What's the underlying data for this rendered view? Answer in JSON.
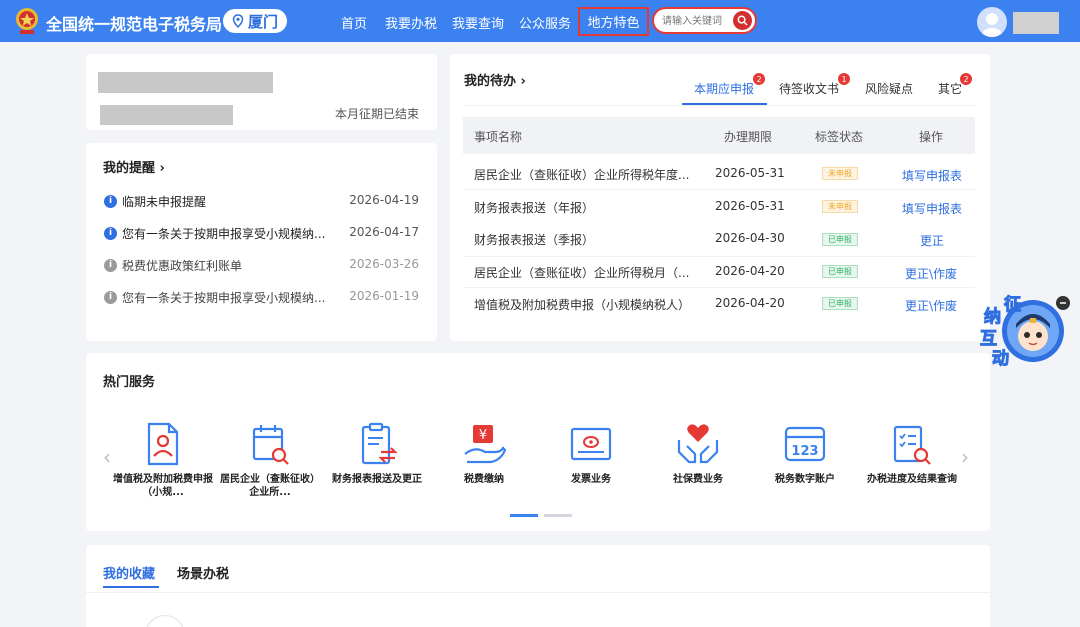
{
  "header": {
    "brand": "全国统一规范电子税务局",
    "city": "厦门",
    "nav": [
      "首页",
      "我要办税",
      "我要查询",
      "公众服务",
      "地方特色"
    ],
    "search_placeholder": "请输入关键词"
  },
  "profile": {
    "status": "本月征期已结束"
  },
  "reminders": {
    "title": "我的提醒",
    "items": [
      {
        "text": "临期未申报提醒",
        "date": "2026-04-19",
        "unread": true
      },
      {
        "text": "您有一条关于按期申报享受小规模纳...",
        "date": "2026-04-17",
        "unread": true
      },
      {
        "text": "税费优惠政策红利账单",
        "date": "2026-03-26",
        "unread": false
      },
      {
        "text": "您有一条关于按期申报享受小规模纳...",
        "date": "2026-01-19",
        "unread": false
      }
    ]
  },
  "todo": {
    "title": "我的待办",
    "tabs": [
      {
        "label": "本期应申报",
        "badge": "2"
      },
      {
        "label": "待签收文书",
        "badge": "1"
      },
      {
        "label": "风险疑点",
        "badge": ""
      },
      {
        "label": "其它",
        "badge": "2"
      }
    ],
    "columns": [
      "事项名称",
      "办理期限",
      "标签状态",
      "操作"
    ],
    "rows": [
      {
        "name": "居民企业（查账征收）企业所得税年度...",
        "deadline": "2026-05-31",
        "status": "未申报",
        "action": "填写申报表"
      },
      {
        "name": "财务报表报送（年报）",
        "deadline": "2026-05-31",
        "status": "未申报",
        "action": "填写申报表"
      },
      {
        "name": "财务报表报送（季报）",
        "deadline": "2026-04-30",
        "status": "已申报",
        "action": "更正"
      },
      {
        "name": "居民企业（查账征收）企业所得税月（...",
        "deadline": "2026-04-20",
        "status": "已申报",
        "action": "更正\\作废"
      },
      {
        "name": "增值税及附加税费申报（小规模纳税人）",
        "deadline": "2026-04-20",
        "status": "已申报",
        "action": "更正\\作废"
      }
    ],
    "colors": {
      "pending": "#f5a623",
      "done": "#34b36b",
      "link": "#2f6fe0",
      "badge": "#e53935"
    }
  },
  "float_widget": {
    "chars": [
      "征",
      "纳",
      "互",
      "动"
    ]
  },
  "hot_services": {
    "title": "热门服务",
    "items": [
      {
        "label": "增值税及附加税费申报（小规...",
        "icon": "person-document-icon"
      },
      {
        "label": "居民企业（查账征收）企业所...",
        "icon": "calendar-search-icon"
      },
      {
        "label": "财务报表报送及更正",
        "icon": "clipboard-exchange-icon"
      },
      {
        "label": "税费缴纳",
        "icon": "yen-hand-icon"
      },
      {
        "label": "发票业务",
        "icon": "invoice-icon"
      },
      {
        "label": "社保费业务",
        "icon": "heart-hands-icon"
      },
      {
        "label": "税务数字账户",
        "icon": "digital-account-icon"
      },
      {
        "label": "办税进度及结果查询",
        "icon": "checklist-search-icon"
      }
    ]
  },
  "favorites": {
    "tabs": [
      "我的收藏",
      "场景办税"
    ]
  }
}
